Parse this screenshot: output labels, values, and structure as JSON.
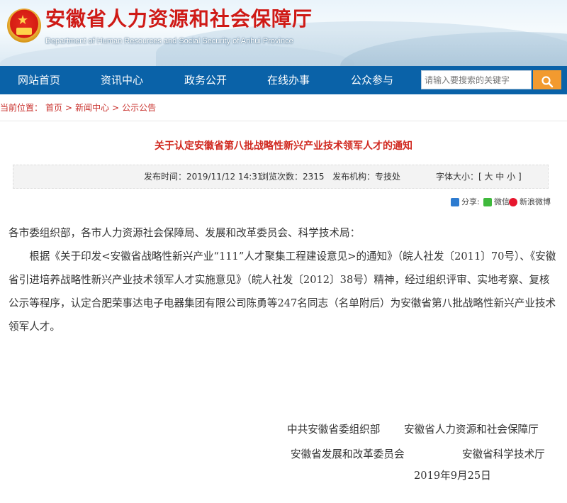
{
  "header": {
    "title": "安徽省人力资源和社会保障厅",
    "subtitle": "Department of Human Resources and Social Security of Anhui Province"
  },
  "nav": {
    "items": [
      {
        "label": "网站首页"
      },
      {
        "label": "资讯中心"
      },
      {
        "label": "政务公开"
      },
      {
        "label": "在线办事"
      },
      {
        "label": "公众参与"
      }
    ]
  },
  "search": {
    "placeholder": "请输入要搜索的关键字",
    "button_icon": "search-icon"
  },
  "breadcrumb": {
    "prefix": "当前位置：",
    "items": [
      "首页",
      ">",
      "新闻中心",
      ">",
      "公示公告"
    ]
  },
  "article": {
    "title": "关于认定安徽省第八批战略性新兴产业技术领军人才的通知",
    "meta": {
      "publish_time": "发布时间：2019/11/12 14:31",
      "views": "浏览次数：2315",
      "org": "发布机构：专技处",
      "font_size": "字体大小：[ 大 中 小 ]"
    },
    "share": {
      "share_label": "分享:",
      "wechat_label": "微信",
      "weibo_label": "新浪微博"
    },
    "salutation": "各市委组织部，各市人力资源社会保障局、发展和改革委员会、科学技术局：",
    "paragraph": "根据《关于印发<安徽省战略性新兴产业“111”人才聚集工程建设意见>的通知》（皖人社发〔2011〕70号）、《安徽省引进培养战略性新兴产业技术领军人才实施意见》（皖人社发〔2012〕38号）精神，经过组织评审、实地考察、复核公示等程序，认定合肥荣事达电子电器集团有限公司陈勇等247名同志（名单附后）为安徽省第八批战略性新兴产业技术领军人才。",
    "signatures": {
      "line1_left": "中共安徽省委组织部",
      "line1_right": "安徽省人力资源和社会保障厅",
      "line2_left": "安徽省发展和改革委员会",
      "line2_right": "安徽省科学技术厅",
      "date": "2019年9月25日"
    }
  },
  "colors": {
    "nav_bg": "#0a62a8",
    "title_red": "#d0281f",
    "search_btn": "#f29a2f"
  }
}
